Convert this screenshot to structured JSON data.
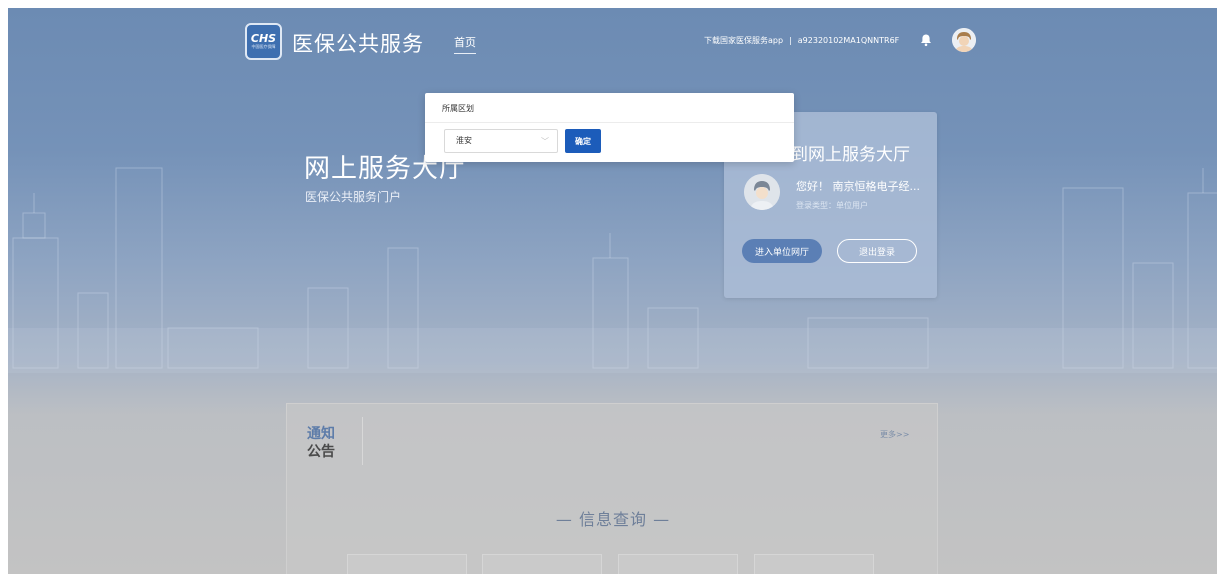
{
  "header": {
    "logo_text": "CHS",
    "logo_subtext": "中国医疗保障",
    "brand": "医保公共服务",
    "nav_home": "首页",
    "download_app": "下载国家医保服务app",
    "separator": "|",
    "account_id": "a92320102MA1QNNTR6F"
  },
  "hero": {
    "title": "网上服务大厅",
    "subtitle": "医保公共服务门户"
  },
  "login_card": {
    "welcome": "到网上服务大厅",
    "hello": "您好！ 南京恒格电子经...",
    "user_type": "登录类型：单位用户",
    "enter_button": "进入单位网厅",
    "logout_button": "退出登录"
  },
  "notice": {
    "tab_line1": "通知",
    "tab_line2": "公告",
    "more": "更多>>",
    "info_query": "— 信息查询 —"
  },
  "modal": {
    "title": "所属区划",
    "select_value": "淮安",
    "confirm_button": "确定"
  },
  "colors": {
    "accent": "#1c5cba",
    "header_bg": "#6c8bb3"
  }
}
